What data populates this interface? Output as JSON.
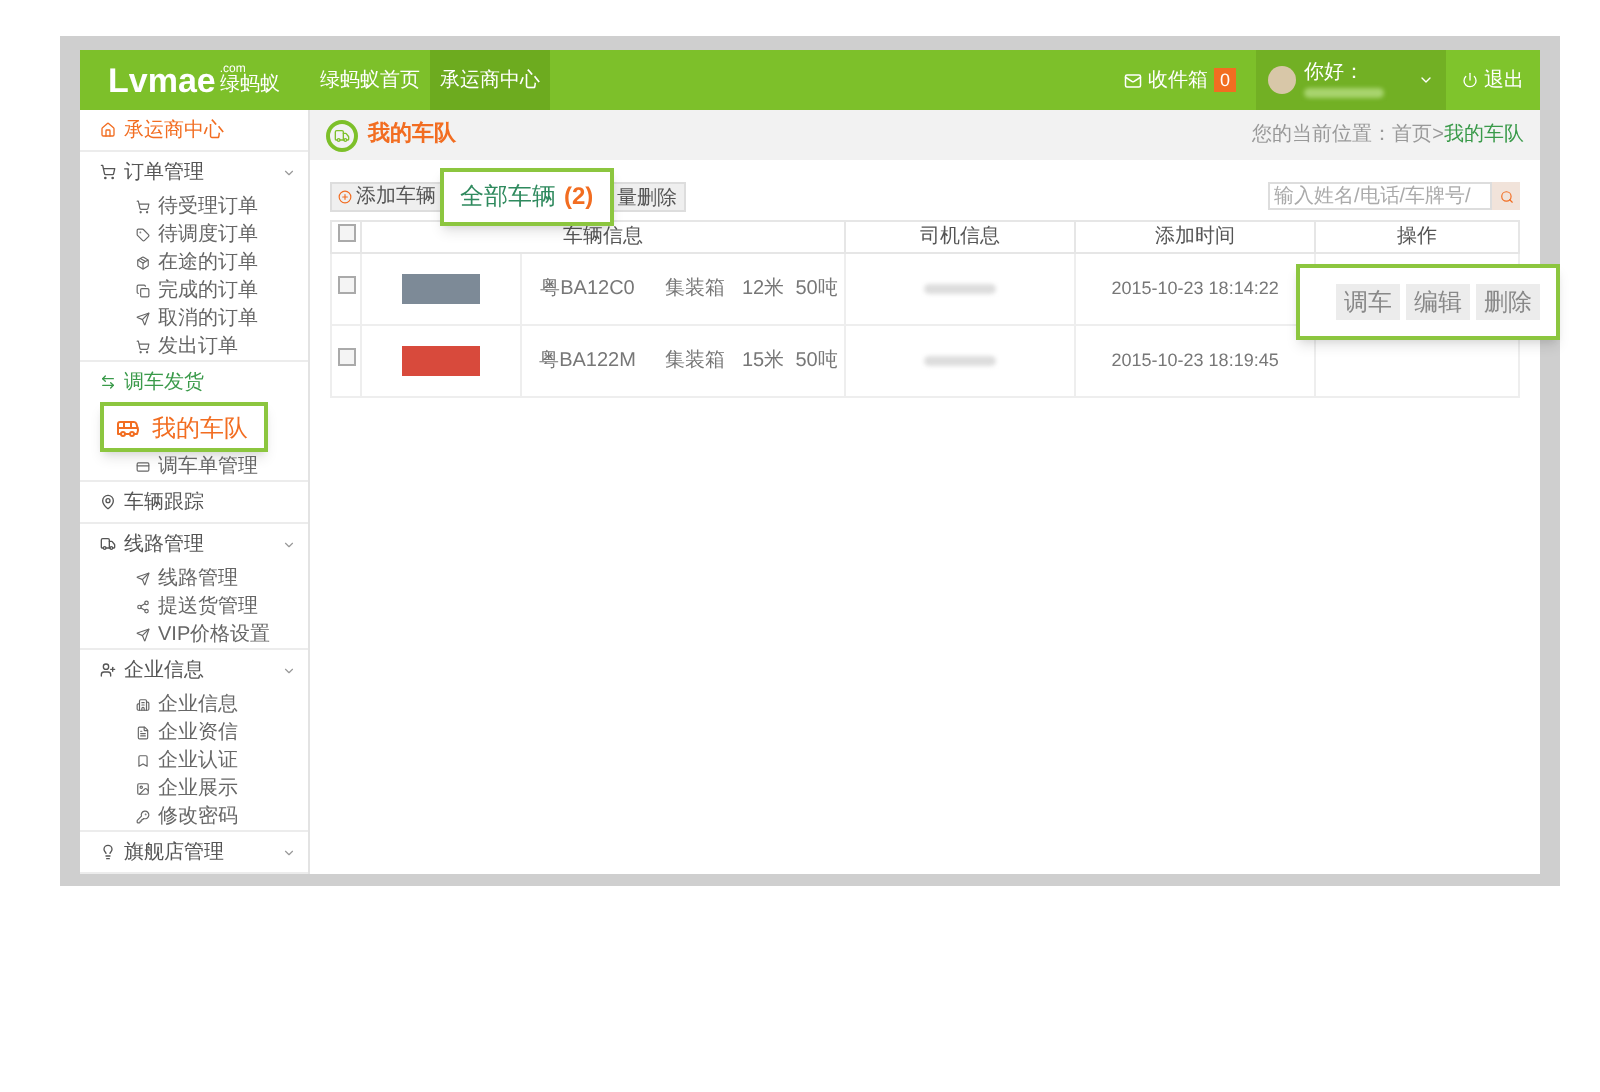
{
  "header": {
    "logo": {
      "brand": "Lvmae",
      "domain": ".com",
      "subtitle": "绿蚂蚁"
    },
    "nav": [
      {
        "label": "绿蚂蚁首页",
        "selected": false
      },
      {
        "label": "承运商中心",
        "selected": true
      }
    ],
    "inbox": {
      "label": "收件箱",
      "count": "0"
    },
    "user": {
      "greeting": "你好："
    },
    "logout": "退出"
  },
  "sidebar": {
    "groups": [
      {
        "label": "承运商中心",
        "selected": true,
        "highlighted": false,
        "expandable": false
      },
      {
        "label": "订单管理",
        "selected": false,
        "highlighted": false,
        "expandable": true,
        "children": [
          "待受理订单",
          "待调度订单",
          "在途的订单",
          "完成的订单",
          "取消的订单",
          "发出订单"
        ]
      },
      {
        "label": "调车发货",
        "selected": false,
        "highlighted": true,
        "expandable": false,
        "callout": "我的车队",
        "children": [
          "调车单管理"
        ]
      },
      {
        "label": "车辆跟踪",
        "selected": false,
        "highlighted": false,
        "expandable": false
      },
      {
        "label": "线路管理",
        "selected": false,
        "highlighted": false,
        "expandable": true,
        "children": [
          "线路管理",
          "提送货管理",
          "VIP价格设置"
        ]
      },
      {
        "label": "企业信息",
        "selected": false,
        "highlighted": false,
        "expandable": true,
        "children": [
          "企业信息",
          "企业资信",
          "企业认证",
          "企业展示",
          "修改密码"
        ]
      },
      {
        "label": "旗舰店管理",
        "selected": false,
        "highlighted": false,
        "expandable": true
      }
    ]
  },
  "page": {
    "title": "我的车队",
    "breadcrumb": {
      "prefix": "您的当前位置：首页>",
      "current": "我的车队"
    }
  },
  "toolbar": {
    "add_button": "添加车辆",
    "callout": {
      "label": "全部车辆",
      "count": "(2)"
    },
    "delete_button": "量删除",
    "search": {
      "placeholder": "输入姓名/电话/车牌号/"
    }
  },
  "table": {
    "select_all": {
      "checked": false
    },
    "columns": [
      "车辆信息",
      "司机信息",
      "添加时间",
      "操作"
    ],
    "rows": [
      {
        "checked": false,
        "plate": "粤BA12C0",
        "type": "集装箱",
        "length": "12米",
        "weight": "50吨",
        "added": "2015-10-23 18:14:22"
      },
      {
        "checked": false,
        "plate": "粤BA122M",
        "type": "集装箱",
        "length": "15米",
        "weight": "50吨",
        "added": "2015-10-23 18:19:45"
      }
    ]
  },
  "actions_callout": [
    "调车",
    "编辑",
    "删除"
  ]
}
